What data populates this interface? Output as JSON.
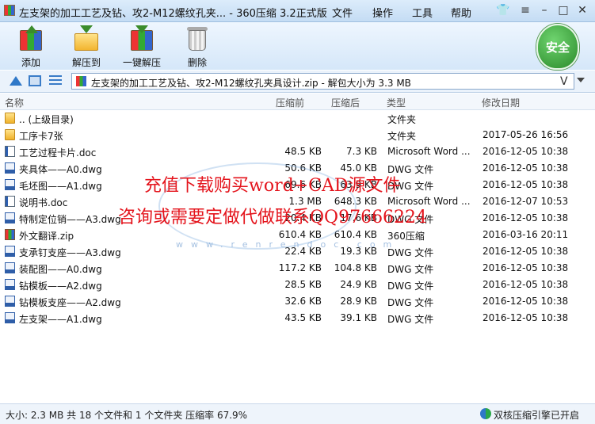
{
  "window": {
    "title": "左支架的加工工艺及钻、攻2-M12螺纹孔夹... - 360压缩 3.2正式版",
    "menu": [
      "文件",
      "操作",
      "工具",
      "帮助"
    ]
  },
  "toolbar": {
    "add": "添加",
    "extract_to": "解压到",
    "one_click_extract": "一键解压",
    "delete": "删除",
    "security_badge": "安全"
  },
  "address": {
    "path": "左支架的加工工艺及钻、攻2-M12螺纹孔夹具设计.zip - 解包大小为 3.3 MB",
    "v_label": "V"
  },
  "columns": {
    "name": "名称",
    "size": "压缩前",
    "compressed": "压缩后",
    "type": "类型",
    "modified": "修改日期"
  },
  "files": [
    {
      "icon": "folder-icon",
      "name": ".. (上级目录)",
      "size": "",
      "compressed": "",
      "type": "文件夹",
      "date": ""
    },
    {
      "icon": "folder-icon",
      "name": "工序卡7张",
      "size": "",
      "compressed": "",
      "type": "文件夹",
      "date": "2017-05-26 16:56"
    },
    {
      "icon": "doc-icon",
      "name": "工艺过程卡片.doc",
      "size": "48.5 KB",
      "compressed": "7.3 KB",
      "type": "Microsoft Word ...",
      "date": "2016-12-05 10:38"
    },
    {
      "icon": "dwg-icon",
      "name": "夹具体——A0.dwg",
      "size": "50.6 KB",
      "compressed": "45.0 KB",
      "type": "DWG 文件",
      "date": "2016-12-05 10:38"
    },
    {
      "icon": "dwg-icon",
      "name": "毛坯图——A1.dwg",
      "size": "69.6 KB",
      "compressed": "63.9 KB",
      "type": "DWG 文件",
      "date": "2016-12-05 10:38"
    },
    {
      "icon": "doc-icon",
      "name": "说明书.doc",
      "size": "1.3 MB",
      "compressed": "648.3 KB",
      "type": "Microsoft Word ...",
      "date": "2016-12-07 10:53"
    },
    {
      "icon": "dwg-icon",
      "name": "特制定位销——A3.dwg",
      "size": "20.4 KB",
      "compressed": "17.6 KB",
      "type": "DWG 文件",
      "date": "2016-12-05 10:38"
    },
    {
      "icon": "zip-icon",
      "name": "外文翻译.zip",
      "size": "610.4 KB",
      "compressed": "610.4 KB",
      "type": "360压缩",
      "date": "2016-03-16 20:11"
    },
    {
      "icon": "dwg-icon",
      "name": "支承钉支座——A3.dwg",
      "size": "22.4 KB",
      "compressed": "19.3 KB",
      "type": "DWG 文件",
      "date": "2016-12-05 10:38"
    },
    {
      "icon": "dwg-icon",
      "name": "装配图——A0.dwg",
      "size": "117.2 KB",
      "compressed": "104.8 KB",
      "type": "DWG 文件",
      "date": "2016-12-05 10:38"
    },
    {
      "icon": "dwg-icon",
      "name": "钻模板——A2.dwg",
      "size": "28.5 KB",
      "compressed": "24.9 KB",
      "type": "DWG 文件",
      "date": "2016-12-05 10:38"
    },
    {
      "icon": "dwg-icon",
      "name": "钻模板支座——A2.dwg",
      "size": "32.6 KB",
      "compressed": "28.9 KB",
      "type": "DWG 文件",
      "date": "2016-12-05 10:38"
    },
    {
      "icon": "dwg-icon",
      "name": "左支架——A1.dwg",
      "size": "43.5 KB",
      "compressed": "39.1 KB",
      "type": "DWG 文件",
      "date": "2016-12-05 10:38"
    }
  ],
  "overlay": {
    "line1": "充值下载购买word+CAD源文件",
    "line2": "咨询或需要定做代做联系QQ97666224",
    "watermark_url": "www.renrendoc.com"
  },
  "status": {
    "summary": "大小: 2.3 MB 共 18 个文件和 1 个文件夹 压缩率 67.9%",
    "engine": "双核压缩引擎已开启"
  }
}
